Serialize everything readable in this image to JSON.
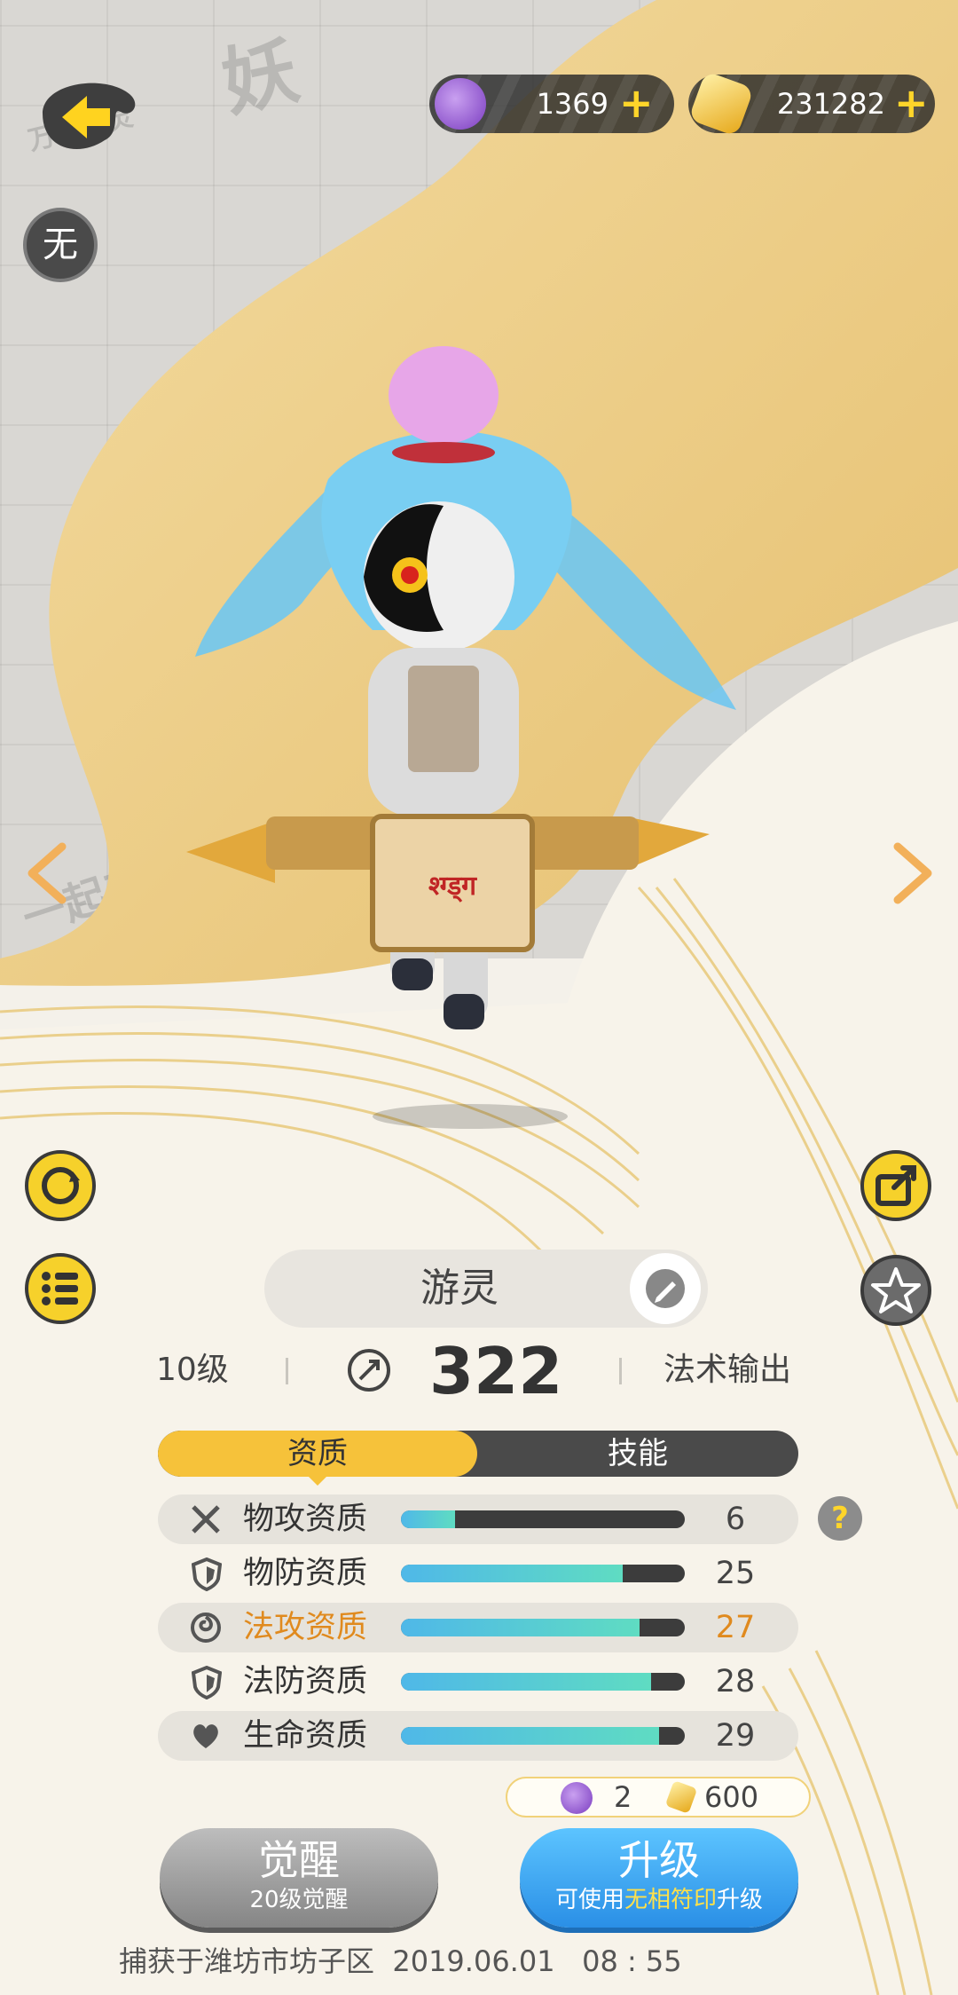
{
  "currencies": [
    {
      "icon": "purple-gem-icon",
      "value": "1369",
      "plus": "+"
    },
    {
      "icon": "gold-crystal-icon",
      "value": "231282",
      "plus": "+"
    }
  ],
  "element_badge": "无",
  "background_stamps": [
    "万物有灵",
    "一起来捉妖",
    "妖"
  ],
  "sign_text": "श्ग्ड्ग",
  "pet": {
    "name": "游灵",
    "level": "10级",
    "power": "322",
    "role": "法术输出"
  },
  "tabs": {
    "active": "资质",
    "inactive": "技能"
  },
  "help_icon_text": "?",
  "stats": [
    {
      "label": "物攻资质",
      "value": "6",
      "fill": 0.19,
      "icon": "crossed-swords-icon",
      "highlight": false
    },
    {
      "label": "物防资质",
      "value": "25",
      "fill": 0.78,
      "icon": "shield-icon",
      "highlight": false
    },
    {
      "label": "法攻资质",
      "value": "27",
      "fill": 0.84,
      "icon": "magic-swirl-icon",
      "highlight": true
    },
    {
      "label": "法防资质",
      "value": "28",
      "fill": 0.88,
      "icon": "shield-icon",
      "highlight": false
    },
    {
      "label": "生命资质",
      "value": "29",
      "fill": 0.91,
      "icon": "heart-icon",
      "highlight": false
    }
  ],
  "cost": {
    "gem": "2",
    "crystal": "600"
  },
  "awaken_button": {
    "title": "觉醒",
    "subtitle": "20级觉醒"
  },
  "upgrade_button": {
    "title": "升级",
    "sub_prefix": "可使用",
    "sub_highlight": "无相符印",
    "sub_suffix": "升级"
  },
  "capture_info": "捕获于潍坊市坊子区  2019.06.01   08 : 55",
  "colors": {
    "accent_yellow": "#f6c23a",
    "button_blue": "#3aa8f2",
    "highlight_orange": "#e08a1e",
    "help_grey": "#8c8c8c"
  }
}
